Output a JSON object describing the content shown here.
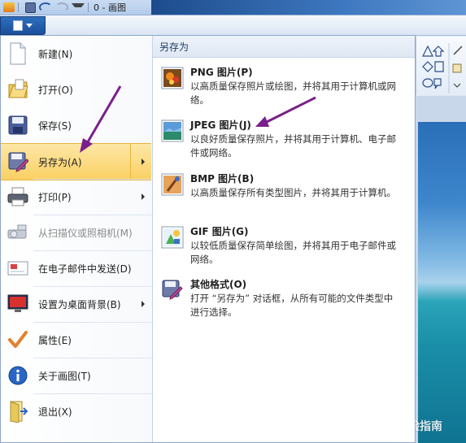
{
  "titlebar": {
    "title": "0 - 画图"
  },
  "menu": {
    "items": [
      {
        "label": "新建(N)",
        "icon": "new-document-icon"
      },
      {
        "label": "打开(O)",
        "icon": "open-folder-icon"
      },
      {
        "label": "保存(S)",
        "icon": "save-disk-icon"
      },
      {
        "label": "另存为(A)",
        "icon": "save-as-icon",
        "active": true
      },
      {
        "label": "打印(P)",
        "icon": "printer-icon"
      },
      {
        "label": "从扫描仪或照相机(M)",
        "icon": "scanner-icon",
        "disabled": true
      },
      {
        "label": "在电子邮件中发送(D)",
        "icon": "email-icon"
      },
      {
        "label": "设置为桌面背景(B)",
        "icon": "desktop-background-icon"
      },
      {
        "label": "属性(E)",
        "icon": "checkmark-icon"
      },
      {
        "label": "关于画图(T)",
        "icon": "info-icon"
      },
      {
        "label": "退出(X)",
        "icon": "exit-icon"
      }
    ]
  },
  "submenu": {
    "header": "另存为",
    "items": [
      {
        "title": "PNG 图片(P)",
        "desc": "以高质量保存照片或绘图，并将其用于计算机或网络。",
        "icon": "png-image-icon"
      },
      {
        "title": "JPEG 图片(J)",
        "desc": "以良好质量保存照片，并将其用于计算机、电子邮件或网络。",
        "icon": "jpeg-image-icon"
      },
      {
        "title": "BMP 图片(B)",
        "desc": "以高质量保存所有类型图片，并将其用于计算机。",
        "icon": "bmp-image-icon"
      },
      {
        "title": "GIF 图片(G)",
        "desc": "以较低质量保存简单绘图，并将其用于电子邮件或网络。",
        "icon": "gif-image-icon"
      },
      {
        "title": "其他格式(O)",
        "desc": "打开 “另存为” 对话框，从所有可能的文件类型中进行选择。",
        "icon": "other-formats-icon"
      }
    ]
  },
  "watermark": "经验指南",
  "colors": {
    "accent": "#1a4f9a",
    "highlight": "#fbd063",
    "annotation": "#7b1f8c"
  }
}
